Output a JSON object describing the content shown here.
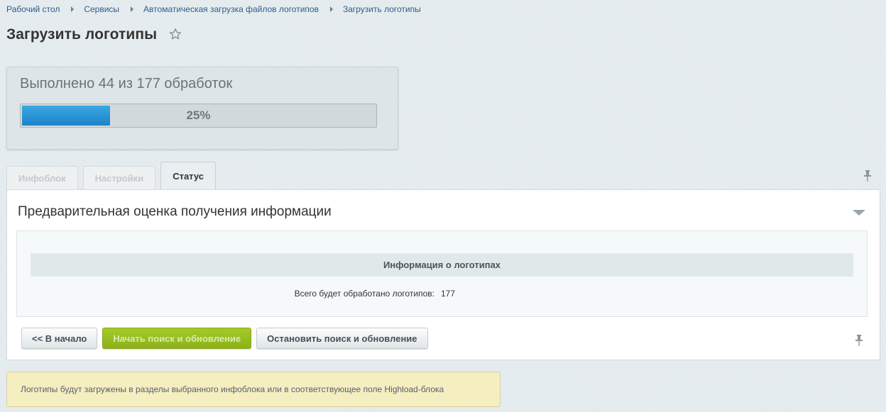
{
  "breadcrumb": [
    {
      "label": "Рабочий стол"
    },
    {
      "label": "Сервисы"
    },
    {
      "label": "Автоматическая загрузка файлов логотипов"
    },
    {
      "label": "Загрузить логотипы"
    }
  ],
  "page": {
    "title": "Загрузить логотипы"
  },
  "progress": {
    "text": "Выполнено 44 из 177 обработок",
    "percent_label": "25%",
    "fraction": 0.25
  },
  "tabs": [
    {
      "label": "Инфоблок",
      "active": false
    },
    {
      "label": "Настройки",
      "active": false
    },
    {
      "label": "Статус",
      "active": true
    }
  ],
  "section": {
    "title": "Предварительная оценка получения информации",
    "info_header": "Информация о логотипах",
    "info_label": "Всего будет обработано логотипов:",
    "info_value": "177"
  },
  "buttons": {
    "back": "<< В начало",
    "start": "Начать поиск и обновление",
    "stop": "Остановить поиск и обновление"
  },
  "notice": "Логотипы будут загружены в разделы выбранного инфоблока или в соответствующее поле Highload-блока",
  "colors": {
    "accent_blue": "#1d83c8",
    "accent_green": "#8db21a",
    "notice_bg": "#f5eec1"
  }
}
